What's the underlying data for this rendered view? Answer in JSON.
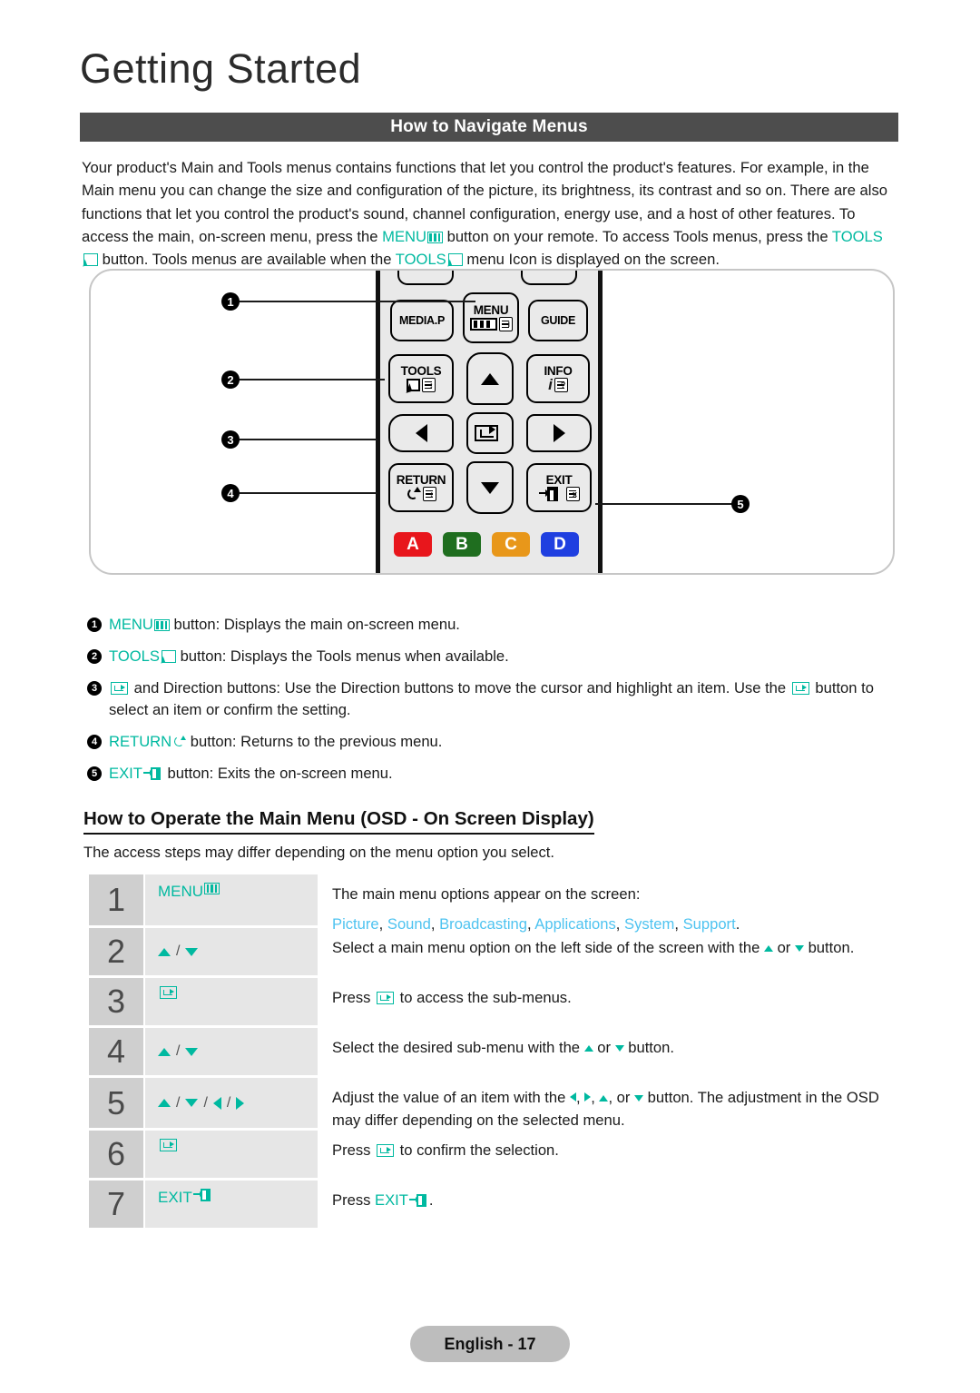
{
  "header": {
    "chapter_title": "Getting Started",
    "section_bar_title": "How to Navigate Menus"
  },
  "intro": {
    "part1": "Your product's Main and Tools menus contains functions that let you control the product's features. For example, in the Main menu you can change the size and configuration of the picture, its brightness, its contrast and so on. There are also functions that let you control the product's sound, channel configuration, energy use, and a host of other features. To access the main, on-screen menu, press the ",
    "menu_label": "MENU",
    "part2": " button on your remote. To access Tools menus, press the ",
    "tools_label": "TOOLS",
    "part3": " button. Tools menus are available when the ",
    "tools_label2": "TOOLS",
    "part4": " menu Icon is displayed on the screen."
  },
  "remote": {
    "callouts": [
      "1",
      "2",
      "3",
      "4",
      "5"
    ],
    "buttons": {
      "media_p": "MEDIA.P",
      "menu": "MENU",
      "guide": "GUIDE",
      "tools": "TOOLS",
      "info": "INFO",
      "return": "RETURN",
      "exit": "EXIT"
    },
    "color_buttons": [
      {
        "label": "A",
        "color": "#e8161c"
      },
      {
        "label": "B",
        "color": "#1f6e1f"
      },
      {
        "label": "C",
        "color": "#e8971a"
      },
      {
        "label": "D",
        "color": "#1f3fe0"
      }
    ]
  },
  "legend": [
    {
      "num": "1",
      "term": "MENU",
      "icon": "menu-icon",
      "text": " button: Displays the main on-screen menu."
    },
    {
      "num": "2",
      "term": "TOOLS",
      "icon": "tools-icon",
      "text": " button: Displays the Tools menus when available."
    },
    {
      "num": "3",
      "term": "",
      "icon": "enter-icon",
      "text_a": " and Direction buttons: Use the Direction buttons to move the cursor and highlight an item. Use the ",
      "text_b": " button to select an item or confirm the setting."
    },
    {
      "num": "4",
      "term": "RETURN",
      "icon": "return-icon",
      "text": " button: Returns to the previous menu."
    },
    {
      "num": "5",
      "term": "EXIT",
      "icon": "exit-icon",
      "text": " button: Exits the on-screen menu."
    }
  ],
  "osd": {
    "heading": "How to Operate the Main Menu (OSD - On Screen Display)",
    "subtext": "The access steps may differ depending on the menu option you select."
  },
  "steps": [
    {
      "num": "1",
      "icon_label": "MENU",
      "icon_type": "menu",
      "desc_line1": "The main menu options appear on the screen:",
      "menu_options": [
        "Picture",
        "Sound",
        "Broadcasting",
        "Applications",
        "System",
        "Support"
      ],
      "menu_options_suffix": "."
    },
    {
      "num": "2",
      "icon_label": "",
      "icon_type": "updown",
      "desc_a": "Select a main menu option on the left side of the screen with the ",
      "desc_b": " or ",
      "desc_c": " button."
    },
    {
      "num": "3",
      "icon_label": "",
      "icon_type": "enter",
      "desc_a": "Press ",
      "desc_b": " to access the sub-menus."
    },
    {
      "num": "4",
      "icon_label": "",
      "icon_type": "updown",
      "desc_a": "Select the desired sub-menu with the ",
      "desc_b": " or ",
      "desc_c": " button."
    },
    {
      "num": "5",
      "icon_label": "",
      "icon_type": "quad",
      "desc_a": "Adjust the value of an item with the ",
      "desc_b": ", ",
      "desc_c": ", ",
      "desc_d": ", or ",
      "desc_e": " button. The adjustment in the OSD may differ depending on the selected menu."
    },
    {
      "num": "6",
      "icon_label": "",
      "icon_type": "enter",
      "desc_a": "Press ",
      "desc_b": " to confirm the selection."
    },
    {
      "num": "7",
      "icon_label": "EXIT",
      "icon_type": "exit",
      "desc_a": "Press ",
      "desc_b": "EXIT",
      "desc_c": "."
    }
  ],
  "footer": {
    "page_label": "English - 17"
  },
  "colors": {
    "teal": "#00b9a0",
    "link_blue": "#4ec3f0",
    "bar_gray": "#4d4d4d"
  }
}
